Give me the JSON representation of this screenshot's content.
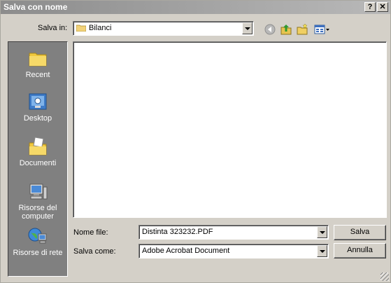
{
  "window": {
    "title": "Salva con nome"
  },
  "lookin": {
    "label": "Salva in:",
    "value": "Bilanci"
  },
  "places": [
    {
      "label": "Recent",
      "icon": "recent-folder-icon"
    },
    {
      "label": "Desktop",
      "icon": "desktop-icon"
    },
    {
      "label": "Documenti",
      "icon": "documents-folder-icon"
    },
    {
      "label": "Risorse del computer",
      "icon": "my-computer-icon"
    },
    {
      "label": "Risorse di rete",
      "icon": "network-places-icon"
    }
  ],
  "filename": {
    "label": "Nome file:",
    "value": "Distinta 323232.PDF"
  },
  "filetype": {
    "label": "Salva come:",
    "value": "Adobe Acrobat Document"
  },
  "buttons": {
    "save": "Salva",
    "cancel": "Annulla",
    "help": "?",
    "close": "✕"
  },
  "colors": {
    "title_bar": "#9a9a9a",
    "face": "#d4d0c8",
    "places_bg": "#808080"
  }
}
